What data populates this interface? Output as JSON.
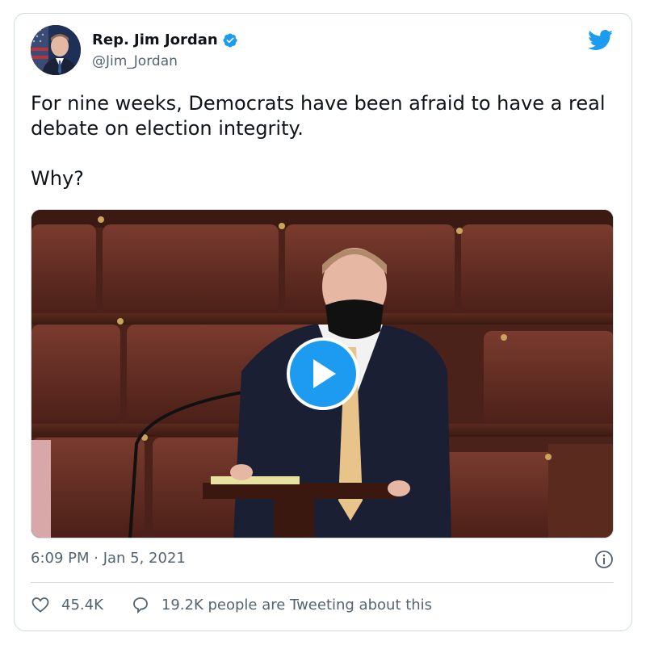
{
  "author": {
    "name": "Rep. Jim Jordan",
    "handle": "@Jim_Jordan",
    "verified": true
  },
  "tweet": {
    "text": "For nine weeks, Democrats have been afraid to have a real debate on election integrity.\n\nWhy?",
    "timestamp": "6:09 PM · Jan 5, 2021"
  },
  "media": {
    "type": "video",
    "play_icon": "play-icon"
  },
  "stats": {
    "likes": "45.4K",
    "tweeting": "19.2K people are Tweeting about this"
  },
  "icons": {
    "brand": "twitter-bird-icon",
    "verified": "verified-badge-icon",
    "info": "info-icon",
    "like": "heart-icon",
    "reply": "reply-bubble-icon"
  },
  "colors": {
    "accent": "#1d9bf0",
    "text": "#0f1419",
    "muted": "#536471",
    "border": "#cfd9de"
  }
}
